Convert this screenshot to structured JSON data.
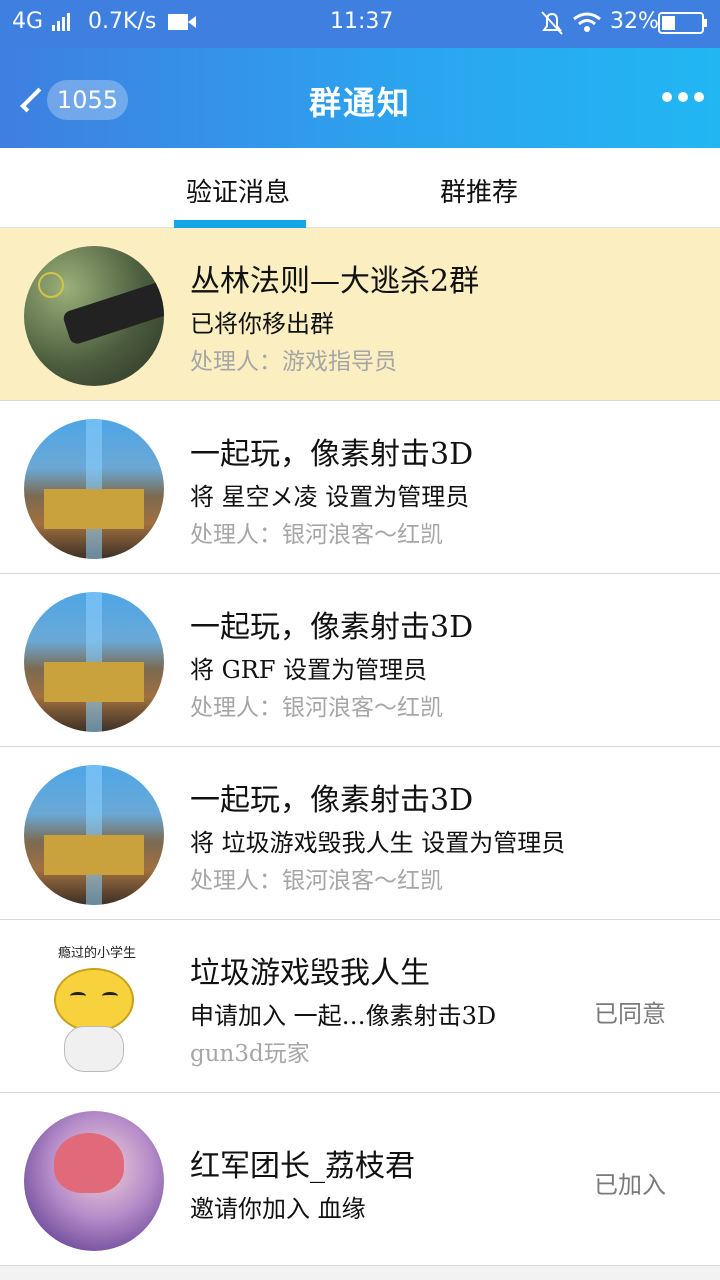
{
  "status_bar": {
    "network": "4G",
    "speed": "0.7K/s",
    "time": "11:37",
    "battery": "32%"
  },
  "header": {
    "back_count": "1055",
    "title": "群通知"
  },
  "tabs": [
    {
      "label": "验证消息",
      "active": true
    },
    {
      "label": "群推荐",
      "active": false
    }
  ],
  "colors": {
    "header_start": "#3f7fe0",
    "header_end": "#22b6f3",
    "tab_indicator": "#12a6e6",
    "highlight_row": "#fbefc2"
  },
  "notifications": [
    {
      "avatar": "sniper-avatar",
      "title": "丛林法则—大逃杀2群",
      "message": "已将你移出群",
      "handler": "处理人：游戏指导员",
      "status": "",
      "highlight": true
    },
    {
      "avatar": "pixel-gun-avatar",
      "title": "一起玩，像素射击3D",
      "message": "将 星空メ凌 设置为管理员",
      "handler": "处理人：银河浪客～红凯",
      "status": ""
    },
    {
      "avatar": "pixel-gun-avatar",
      "title": "一起玩，像素射击3D",
      "message": "将 GRF 设置为管理员",
      "handler": "处理人：银河浪客～红凯",
      "status": ""
    },
    {
      "avatar": "pixel-gun-avatar",
      "title": "一起玩，像素射击3D",
      "message": "将 垃圾游戏毁我人生 设置为管理员",
      "handler": "处理人：银河浪客～红凯",
      "status": ""
    },
    {
      "avatar": "emoji-face-avatar",
      "avatar_caption": "瘾过的小学生",
      "title": "垃圾游戏毁我人生",
      "message": "申请加入 一起…像素射击3D",
      "handler": "gun3d玩家",
      "status": "已同意"
    },
    {
      "avatar": "anime-girl-avatar",
      "title": "红军团长_荔枝君",
      "message": "邀请你加入 血缘",
      "handler": "",
      "status": "已加入"
    }
  ]
}
